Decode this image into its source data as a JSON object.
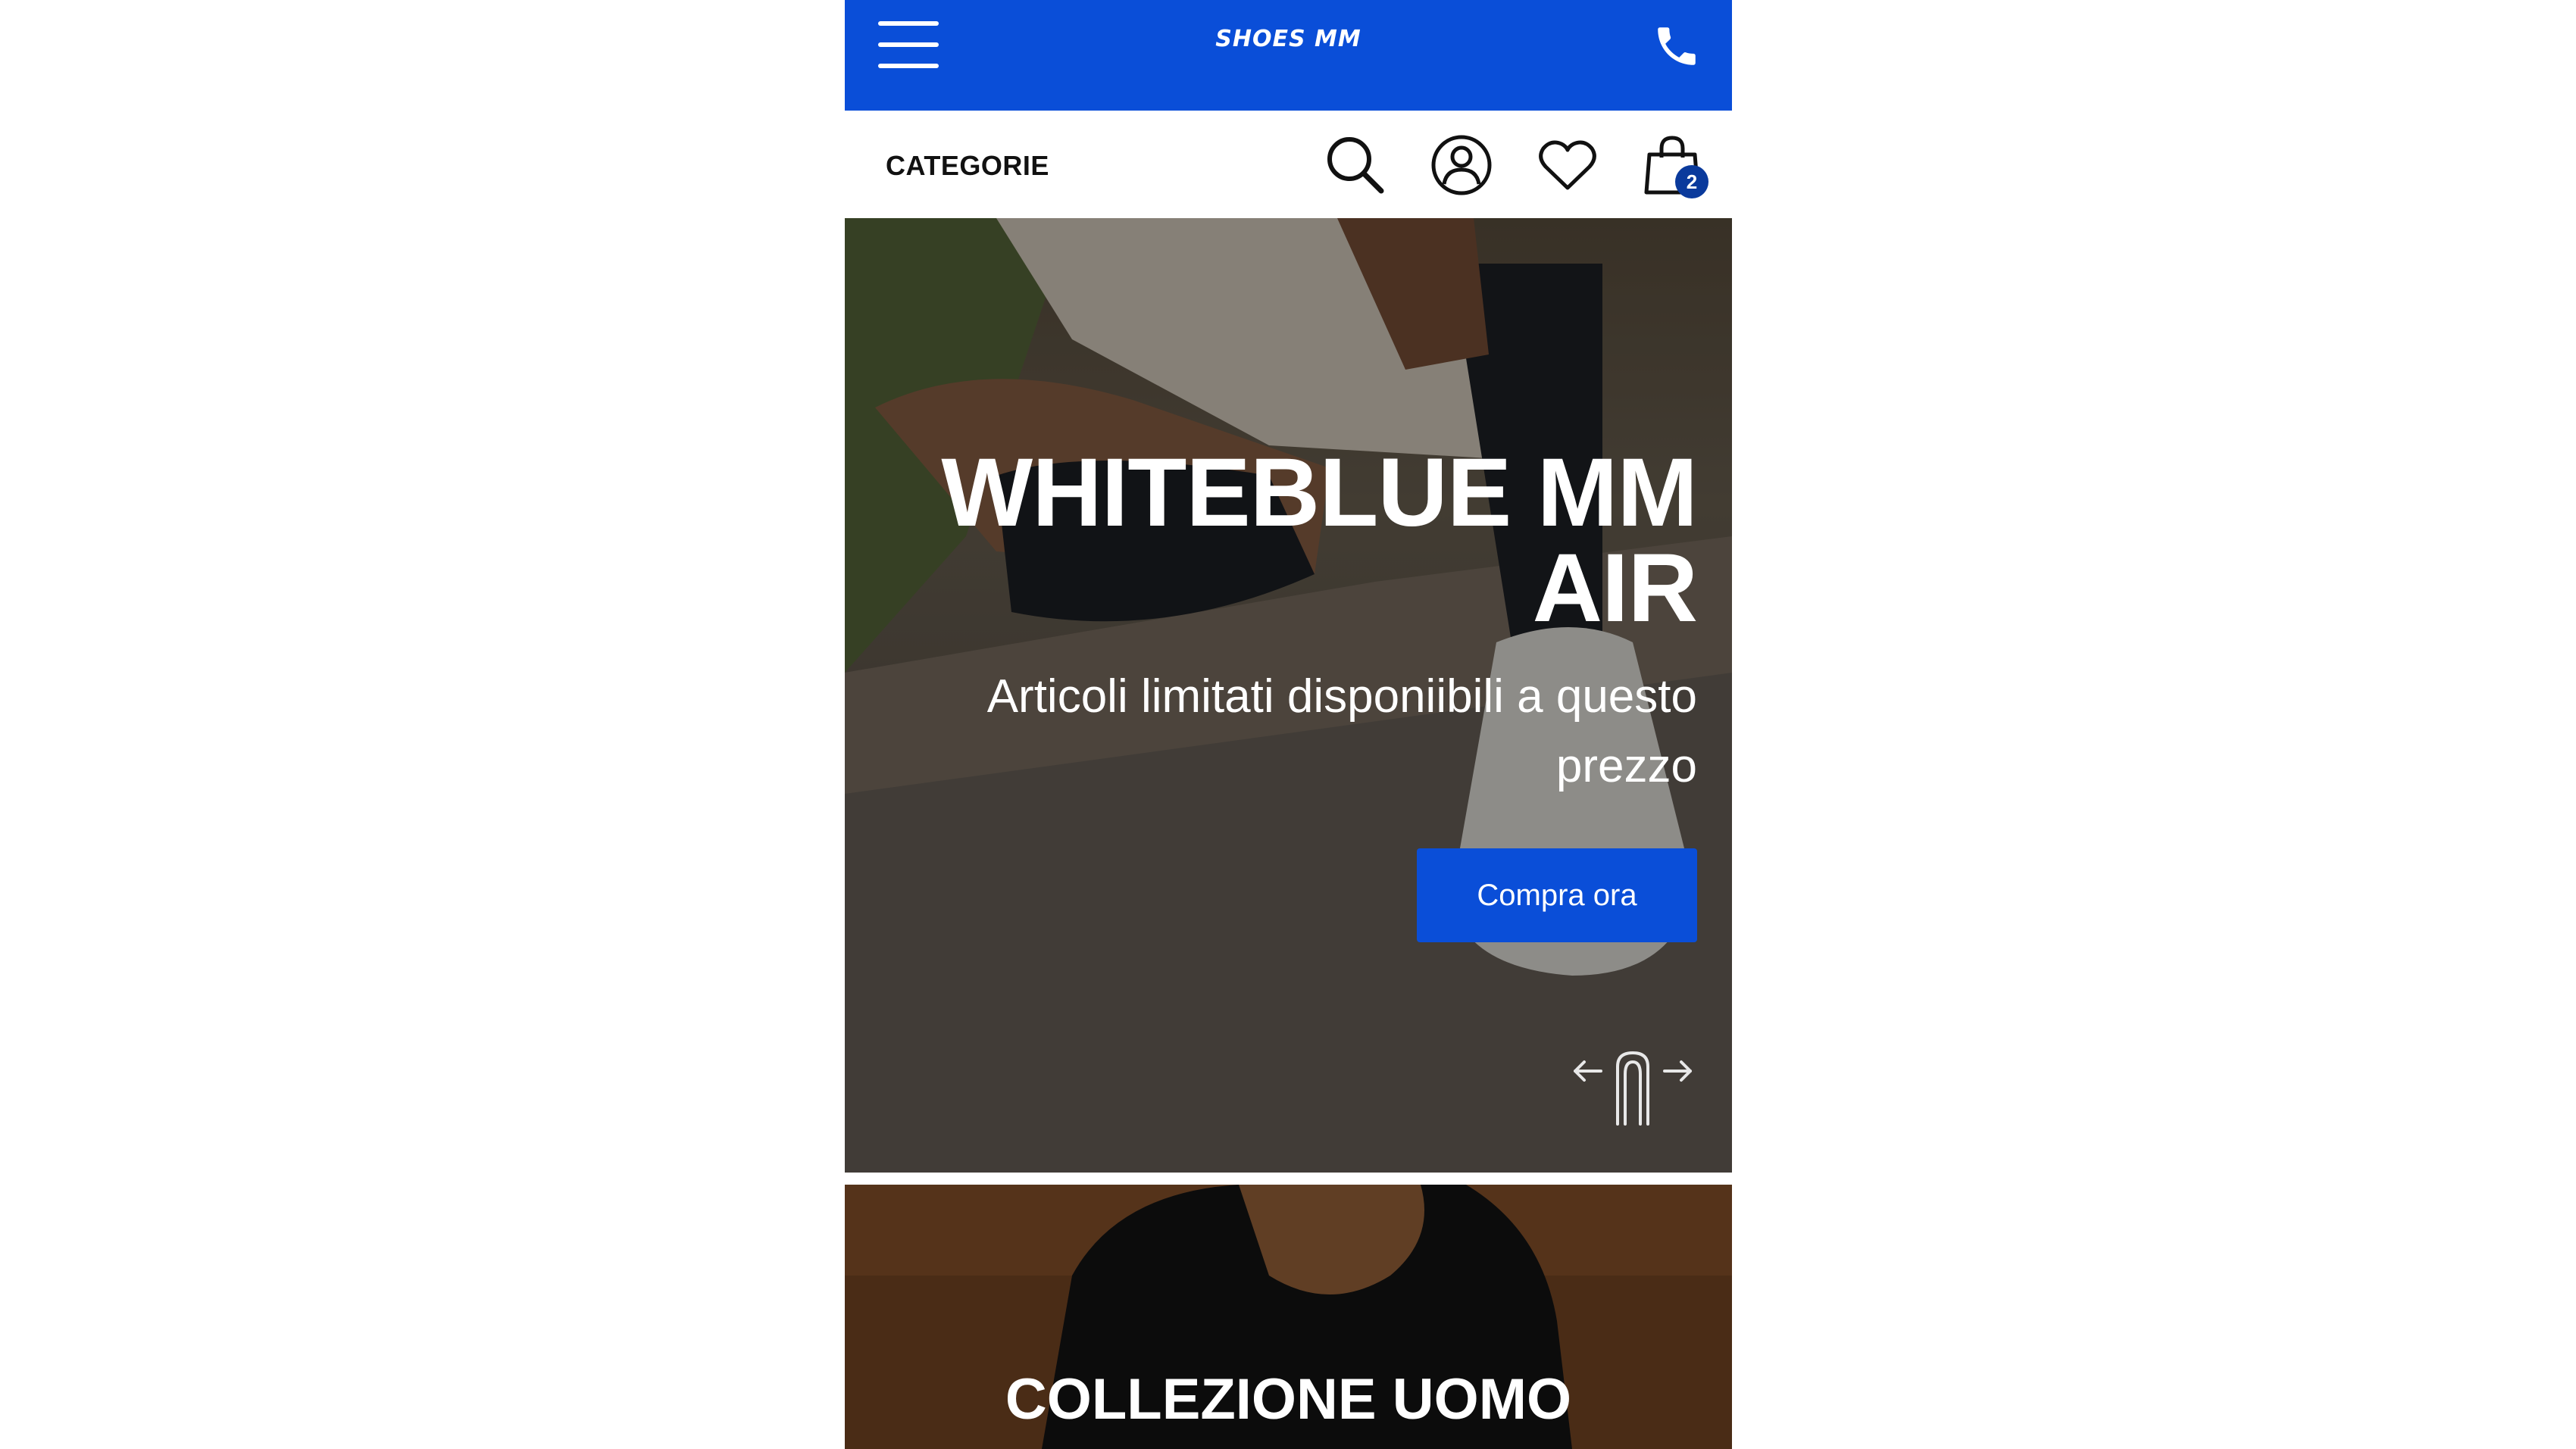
{
  "header": {
    "brand": "SHOES MM",
    "menu_icon": "hamburger-menu-icon",
    "phone_icon": "phone-icon",
    "bar_color": "#0a4ed8"
  },
  "subnav": {
    "categories_label": "CATEGORIE",
    "icons": [
      "search-icon",
      "user-account-icon",
      "heart-icon",
      "shopping-bag-icon"
    ],
    "cart_count": "2"
  },
  "hero": {
    "title": "WHITEBLUE MM AIR",
    "subtitle": "Articoli limitati disponiibili a questo prezzo",
    "cta_label": "Compra ora",
    "swipe_hint_icon": "swipe-gesture-icon"
  },
  "banner2": {
    "title": "COLLEZIONE UOMO"
  }
}
